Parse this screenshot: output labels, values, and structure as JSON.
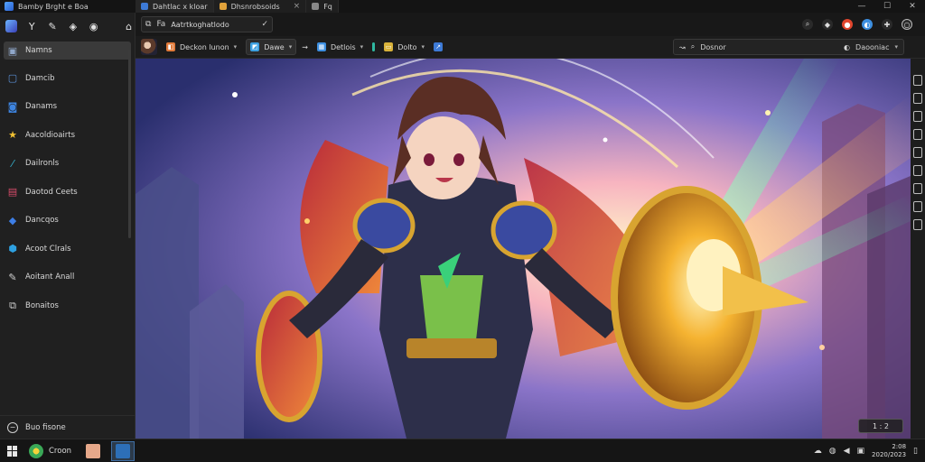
{
  "window": {
    "app_title": "Bamby Brght e Boa",
    "tabs": [
      {
        "label": "Dahtlac x kloar",
        "color": "#3d7ad6"
      },
      {
        "label": "Dhsnrobsoids",
        "color": "#e0a13a"
      },
      {
        "label": "Fq",
        "color": "#888888"
      }
    ],
    "tab_close": "×",
    "controls": [
      "—",
      "☐",
      "✕"
    ]
  },
  "sidebar": {
    "toolbar_icons": [
      "logo-icon",
      "y-icon",
      "pen-icon",
      "drop-icon",
      "circle-icon",
      "home-icon"
    ],
    "items": [
      {
        "label": "Namns",
        "icon": "image-icon",
        "color": "#8fa6c8",
        "selected": true
      },
      {
        "label": "Damcib",
        "icon": "square-icon",
        "color": "#5a8fd6"
      },
      {
        "label": "Danams",
        "icon": "photo-icon",
        "color": "#3d84e0"
      },
      {
        "label": "Aacoldioairts",
        "icon": "star-icon",
        "color": "#f2c233"
      },
      {
        "label": "Dailronls",
        "icon": "brush-icon",
        "color": "#37b8d6"
      },
      {
        "label": "Daotod Ceets",
        "icon": "calendar-icon",
        "color": "#d64b6a"
      },
      {
        "label": "Dancqos",
        "icon": "tag-icon",
        "color": "#3d7ee6"
      },
      {
        "label": "Acoot Clrals",
        "icon": "shield-icon",
        "color": "#2ea0e0"
      },
      {
        "label": "Aoitant Anall",
        "icon": "tool-icon",
        "color": "#d0d0d0"
      },
      {
        "label": "Bonaitos",
        "icon": "box-icon",
        "color": "#d0d0d0"
      }
    ],
    "footer_label": "Buo fisone"
  },
  "address": {
    "prefix": "Fa",
    "text": "Aatrtkoghatlodo",
    "right_icons": [
      {
        "name": "search-icon",
        "glyph": "⌕",
        "color": "#2a2a2a"
      },
      {
        "name": "bag-icon",
        "glyph": "◆",
        "color": "#2a2a2a"
      },
      {
        "name": "record-icon",
        "glyph": "●",
        "color": "#e0452d"
      },
      {
        "name": "sync-icon",
        "glyph": "◐",
        "color": "#3d8fe0"
      },
      {
        "name": "extension-icon",
        "glyph": "✚",
        "color": "#2a2a2a"
      },
      {
        "name": "profile-icon",
        "glyph": "○",
        "color": "#2a2a2a"
      }
    ]
  },
  "toolbar": {
    "buttons": [
      {
        "label": "Deckon lunon",
        "color": "#e07a3a",
        "boxed": false
      },
      {
        "label": "Dawe",
        "color": "#3da0e0",
        "boxed": true
      },
      {
        "label": "Detlois",
        "color": "#3d8fe0",
        "boxed": false
      },
      {
        "label": "Dolto",
        "color": "#d8b23a",
        "boxed": false
      }
    ],
    "search_label": "Dosnor",
    "search_filter": "Daooniac"
  },
  "canvas": {
    "zoom_label": "1 : 2"
  },
  "taskbar": {
    "apps": [
      {
        "label": "Croon",
        "color": "#3aa857"
      },
      {
        "label": "",
        "color": "#e6a88a"
      },
      {
        "label": "",
        "color": "#2d6fb8"
      }
    ],
    "clock_time": "2:08",
    "clock_date": "2020/2023"
  }
}
